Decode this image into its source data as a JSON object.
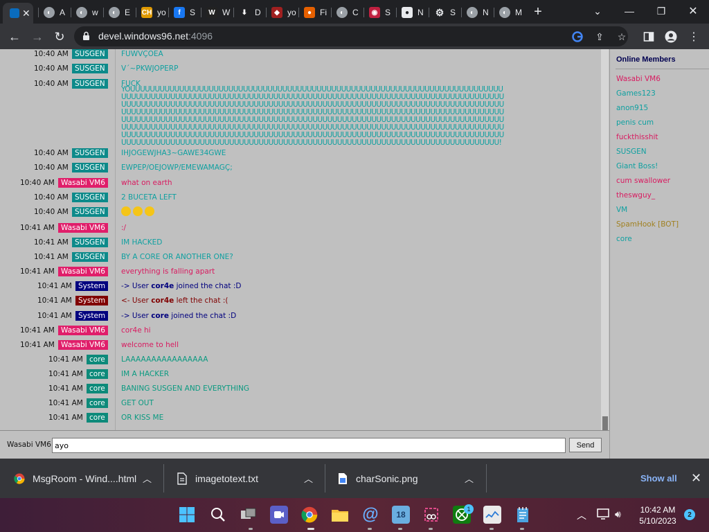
{
  "browser": {
    "tabs": [
      {
        "title": "",
        "icon": "windows96-icon",
        "active": true
      },
      {
        "title": "A",
        "icon": "globe-icon"
      },
      {
        "title": "w",
        "icon": "globe-icon"
      },
      {
        "title": "E",
        "icon": "globe-icon"
      },
      {
        "title": "yo",
        "icon": "ch-icon"
      },
      {
        "title": "S",
        "icon": "facebook-icon"
      },
      {
        "title": "W",
        "icon": "wtf-icon"
      },
      {
        "title": "D",
        "icon": "download-icon"
      },
      {
        "title": "yo",
        "icon": "shield-icon"
      },
      {
        "title": "Fi",
        "icon": "firefox-icon"
      },
      {
        "title": "C",
        "icon": "globe-icon"
      },
      {
        "title": "S",
        "icon": "target-icon"
      },
      {
        "title": "N",
        "icon": "github-icon"
      },
      {
        "title": "S",
        "icon": "gear-icon"
      },
      {
        "title": "N",
        "icon": "globe-icon"
      },
      {
        "title": "M",
        "icon": "globe-icon"
      }
    ],
    "url_host": "devel.windows96.net",
    "url_port": ":4096"
  },
  "chat": {
    "messages": [
      {
        "time": "10:40 AM",
        "user": "SUSGEN",
        "kind": "sus",
        "text": "FUWVÇOEA"
      },
      {
        "time": "10:40 AM",
        "user": "SUSGEN",
        "kind": "sus",
        "text": "V´~PKWJOPERP"
      },
      {
        "time": "10:40 AM",
        "user": "SUSGEN",
        "kind": "sus",
        "text": "FUCK"
      },
      {
        "time": "10:40 AM",
        "user": "SUSGEN",
        "kind": "sus",
        "text": "IHJOGEWJHA3~GAWE34GWE"
      },
      {
        "time": "10:40 AM",
        "user": "SUSGEN",
        "kind": "sus",
        "text": "EWPEP/OEJOWP/EMEWAMAGÇ;"
      },
      {
        "time": "10:40 AM",
        "user": "Wasabi VM6",
        "kind": "was",
        "text": "what on earth"
      },
      {
        "time": "10:40 AM",
        "user": "SUSGEN",
        "kind": "sus",
        "text": "2 BUCETA LEFT"
      },
      {
        "time": "10:40 AM",
        "user": "SUSGEN",
        "kind": "sus",
        "text": ""
      },
      {
        "time": "10:41 AM",
        "user": "Wasabi VM6",
        "kind": "was",
        "text": ":/"
      },
      {
        "time": "10:41 AM",
        "user": "SUSGEN",
        "kind": "sus",
        "text": "IM HACKED"
      },
      {
        "time": "10:41 AM",
        "user": "SUSGEN",
        "kind": "sus",
        "text": "BY A CORE OR ANOTHER ONE?"
      },
      {
        "time": "10:41 AM",
        "user": "Wasabi VM6",
        "kind": "was",
        "text": "everything is falling apart"
      },
      {
        "time": "10:41 AM",
        "user": "System",
        "kind": "sys",
        "pre": "-> User ",
        "bold": "cor4e",
        "post": " joined the chat :D"
      },
      {
        "time": "10:41 AM",
        "user": "System",
        "kind": "sysred",
        "pre": "<- User ",
        "bold": "cor4e",
        "post": " left the chat :("
      },
      {
        "time": "10:41 AM",
        "user": "System",
        "kind": "sys",
        "pre": "-> User ",
        "bold": "core",
        "post": " joined the chat :D"
      },
      {
        "time": "10:41 AM",
        "user": "Wasabi VM6",
        "kind": "was",
        "text": "cor4e hi"
      },
      {
        "time": "10:41 AM",
        "user": "Wasabi VM6",
        "kind": "was",
        "text": "welcome to hell"
      },
      {
        "time": "10:41 AM",
        "user": "core",
        "kind": "core",
        "text": "LAAAAAAAAAAAAAAAA"
      },
      {
        "time": "10:41 AM",
        "user": "core",
        "kind": "core",
        "text": "IM A HACKER"
      },
      {
        "time": "10:41 AM",
        "user": "core",
        "kind": "core",
        "text": "BANING SUSGEN AND EVERYTHING"
      },
      {
        "time": "10:41 AM",
        "user": "core",
        "kind": "core",
        "text": "GET OUT"
      },
      {
        "time": "10:41 AM",
        "user": "core",
        "kind": "core",
        "text": "OR KISS ME"
      }
    ],
    "long_lines": [
      "YOUUUUUUUUUUUUUUUUUUUUUUUUUUUUUUUUUUUUUUUUUUUUUUUUUUUUUUUUUUUUUUUUUUUUUUUUUUUU",
      "UUUUUUUUUUUUUUUUUUUUUUUUUUUUUUUUUUUUUUUUUUUUUUUUUUUUUUUUUUUUUUUUUUUUUUUUUUUUUU",
      "UUUUUUUUUUUUUUUUUUUUUUUUUUUUUUUUUUUUUUUUUUUUUUUUUUUUUUUUUUUUUUUUUUUUUUUUUUUUUU",
      "UUUUUUUUUUUUUUUUUUUUUUUUUUUUUUUUUUUUUUUUUUUUUUUUUUUUUUUUUUUUUUUUUUUUUUUUUUUUUU",
      "UUUUUUUUUUUUUUUUUUUUUUUUUUUUUUUUUUUUUUUUUUUUUUUUUUUUUUUUUUUUUUUUUUUUUUUUUUUUUU",
      "UUUUUUUUUUUUUUUUUUUUUUUUUUUUUUUUUUUUUUUUUUUUUUUUUUUUUUUUUUUUUUUUUUUUUUUUUUUUUU",
      "UUUUUUUUUUUUUUUUUUUUUUUUUUUUUUUUUUUUUUUUUUUUUUUUUUUUUUUUUUUUUUUUUUUUUUUUUUUUUU",
      "UUUUUUUUUUUUUUUUUUUUUUUUUUUUUUUUUUUUUUUUUUUUUUUUUUUUUUUUUUUUUUUUUUUUUUUUUUUUU!"
    ]
  },
  "members": {
    "title": "Online Members",
    "list": [
      {
        "name": "Wasabi VM6",
        "color": "#d81b60"
      },
      {
        "name": "Games123",
        "color": "#0fa0a0"
      },
      {
        "name": "anon915",
        "color": "#0fa0a0"
      },
      {
        "name": "penis cum",
        "color": "#0fa0a0"
      },
      {
        "name": "fuckthisshit",
        "color": "#d81b60"
      },
      {
        "name": "SUSGEN",
        "color": "#0fa0a0"
      },
      {
        "name": "Giant Boss!",
        "color": "#0fa0a0"
      },
      {
        "name": "cum swallower",
        "color": "#d81b60"
      },
      {
        "name": "theswguy_",
        "color": "#d81b60"
      },
      {
        "name": "VM",
        "color": "#0fa0a0"
      },
      {
        "name": "SpamHook [BOT]",
        "color": "#a08020"
      },
      {
        "name": "core",
        "color": "#0fa0a0"
      }
    ]
  },
  "input": {
    "nick": "Wasabi VM6",
    "value": "ayo",
    "send_label": "Send"
  },
  "downloads": {
    "items": [
      {
        "name": "MsgRoom - Wind....html",
        "icon": "chrome-icon"
      },
      {
        "name": "imagetotext.txt",
        "icon": "file-icon"
      },
      {
        "name": "charSonic.png",
        "icon": "image-file-icon"
      }
    ],
    "show_all": "Show all"
  },
  "taskbar": {
    "time": "10:42 AM",
    "date": "5/10/2023",
    "notifications": "2",
    "app_badge": "1",
    "calendar_day": "18"
  }
}
